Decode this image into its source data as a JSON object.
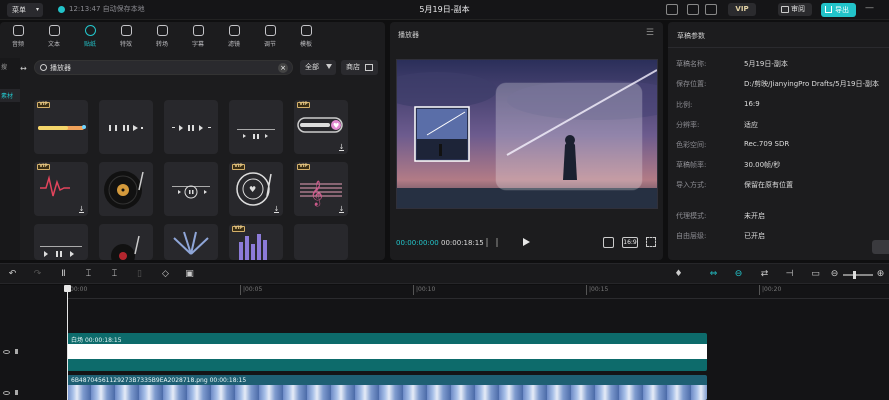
{
  "titlebar": {
    "menu_label": "菜单",
    "autosave_text": "12:13:47 自动保存本地",
    "project_title": "5月19日-副本",
    "vip_label": "VIP",
    "review_label": "审阅",
    "export_label": "导出"
  },
  "tools": [
    {
      "label": "音频",
      "icon": "audio-icon"
    },
    {
      "label": "文本",
      "icon": "text-icon"
    },
    {
      "label": "贴纸",
      "icon": "sticker-icon",
      "active": true
    },
    {
      "label": "特效",
      "icon": "effects-icon"
    },
    {
      "label": "转场",
      "icon": "transition-icon"
    },
    {
      "label": "字幕",
      "icon": "subtitle-icon"
    },
    {
      "label": "滤镜",
      "icon": "filter-icon"
    },
    {
      "label": "调节",
      "icon": "adjust-icon"
    },
    {
      "label": "模板",
      "icon": "template-icon"
    }
  ],
  "sidebar": {
    "items": [
      {
        "label": "搜"
      },
      {
        "label": "素材",
        "selected": true
      }
    ]
  },
  "search": {
    "value": "播放器",
    "filter_label": "全部",
    "store_label": "商店"
  },
  "player": {
    "title": "播放器",
    "current_time": "00:00:00:00",
    "total_time": "00:00:18:15",
    "ratio_label": "16:9"
  },
  "draft": {
    "title": "草稿参数",
    "rows": [
      {
        "key": "草稿名称:",
        "value": "5月19日-副本"
      },
      {
        "key": "保存位置:",
        "value": "D:/剪映/JianyingPro Drafts/5月19日-副本"
      },
      {
        "key": "比例:",
        "value": "16:9"
      },
      {
        "key": "分辨率:",
        "value": "适应"
      },
      {
        "key": "色彩空间:",
        "value": "Rec.709 SDR"
      },
      {
        "key": "草稿帧率:",
        "value": "30.00帧/秒"
      },
      {
        "key": "导入方式:",
        "value": "保留在原有位置"
      },
      {
        "key": "代理模式:",
        "value": "未开启"
      },
      {
        "key": "自由层级:",
        "value": "已开启"
      }
    ]
  },
  "timeline": {
    "ticks": [
      "00:00",
      "|00:05",
      "|00:10",
      "|00:15",
      "|00:20"
    ],
    "text_clip": {
      "name": "白场",
      "duration": "00:00:18:15"
    },
    "image_clip": {
      "name": "6B48704561129273B7335B9EA2028718.png",
      "duration": "00:00:18:15"
    }
  },
  "colors": {
    "accent": "#22c3c9",
    "text_clip": "#0d6b6b",
    "image_clip": "#1e5f73"
  }
}
